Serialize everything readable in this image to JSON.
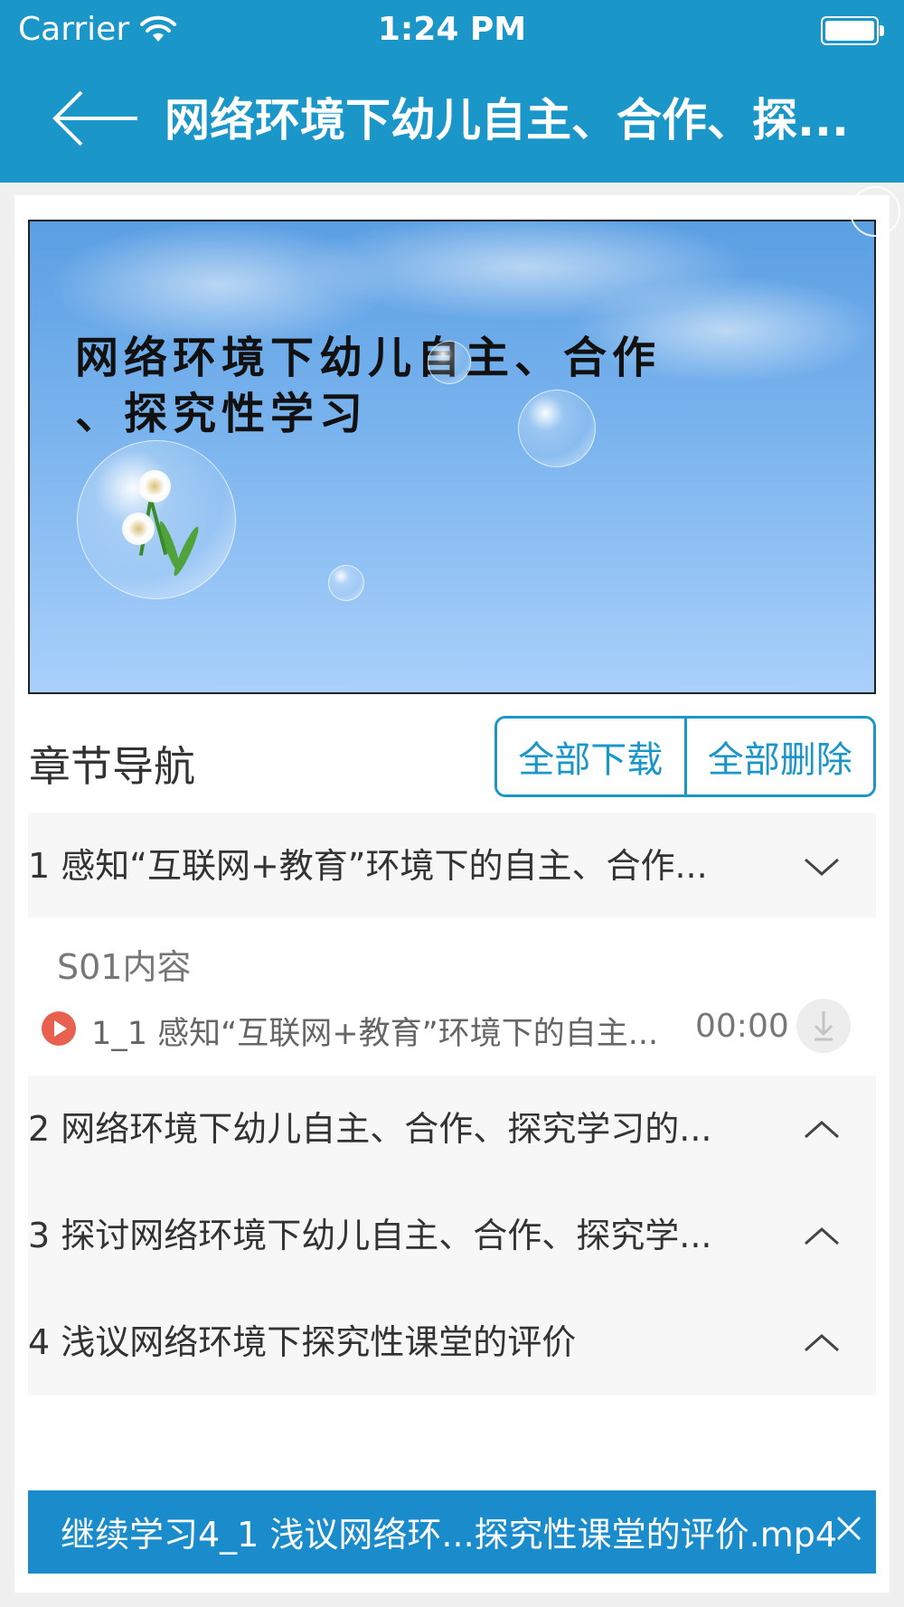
{
  "status_bar": {
    "carrier": "Carrier",
    "time": "1:24 PM"
  },
  "header": {
    "title": "网络环境下幼儿自主、合作、探..."
  },
  "cover": {
    "line1": "网络环境下幼儿自主、合作",
    "line2": "、探究性学习"
  },
  "nav": {
    "title": "章节导航",
    "download_all": "全部下载",
    "delete_all": "全部删除"
  },
  "chapters": [
    {
      "label": "1 感知“互联网+教育”环境下的自主、合作...",
      "expanded": true
    },
    {
      "label": "2 网络环境下幼儿自主、合作、探究学习的...",
      "expanded": false
    },
    {
      "label": "3 探讨网络环境下幼儿自主、合作、探究学...",
      "expanded": false
    },
    {
      "label": "4 浅议网络环境下探究性课堂的评价",
      "expanded": false
    }
  ],
  "section": {
    "label": "S01内容",
    "lesson": {
      "label": "1_1 感知“互联网+教育”环境下的自主...",
      "duration": "00:00"
    }
  },
  "continue": {
    "text": "继续学习4_1 浅议网络环...探究性课堂的评价.mp4"
  },
  "colors": {
    "primary": "#1a97c8",
    "play": "#e8604f"
  },
  "icons": [
    "wifi-icon",
    "battery-icon",
    "back-arrow-icon",
    "chevron-down-icon",
    "chevron-up-icon",
    "play-icon",
    "download-icon",
    "close-icon"
  ]
}
